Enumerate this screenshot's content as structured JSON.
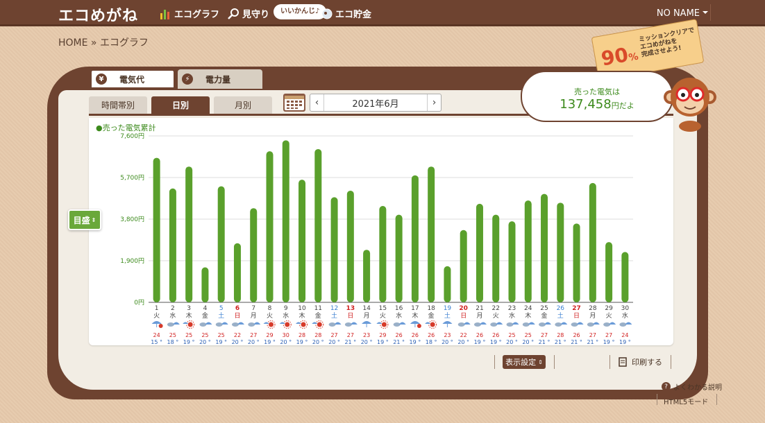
{
  "header": {
    "logo": "エコめがね",
    "nav": [
      {
        "label": "エコグラフ",
        "icon": "bar-chart-icon"
      },
      {
        "label": "見守り",
        "icon": "magnifier-icon"
      },
      {
        "label": "エコ貯金",
        "icon": "piggy-bank-icon"
      }
    ],
    "pill": "いいかんじ♪",
    "user": "NO NAME"
  },
  "breadcrumb": "HOME » エコグラフ",
  "tabs": [
    {
      "label": "電気代",
      "icon_text": "¥"
    },
    {
      "label": "電力量",
      "icon_text": "⚡"
    }
  ],
  "subtabs": [
    "時間帯別",
    "日別",
    "月別"
  ],
  "date": "2021年6月",
  "mission": {
    "percent": "90",
    "unit": "%",
    "text1": "ミッションクリアで",
    "text2": "エコめがねを",
    "text3": "完成させよう!"
  },
  "bubble": {
    "line1": "売った電気は",
    "amount": "137,458",
    "unit": "円だよ"
  },
  "meter_button": "目盛",
  "series_label": "●売った電気累計",
  "colors": {
    "bar": "#5aa02c",
    "brown": "#6e4330",
    "sat": "#3a7fd0",
    "sun": "#d02020",
    "high": "#d02020",
    "low": "#2b5fb3"
  },
  "chart_data": {
    "type": "bar",
    "ylim": [
      0,
      7600
    ],
    "yticks": [
      "0円",
      "1,900円",
      "3,800円",
      "5,700円",
      "7,600円"
    ],
    "ytick_values": [
      0,
      1900,
      3800,
      5700,
      7600
    ],
    "days": [
      "1",
      "2",
      "3",
      "4",
      "5",
      "6",
      "7",
      "8",
      "9",
      "10",
      "11",
      "12",
      "13",
      "14",
      "15",
      "16",
      "17",
      "18",
      "19",
      "20",
      "21",
      "22",
      "23",
      "24",
      "25",
      "26",
      "27",
      "28",
      "29",
      "30"
    ],
    "weekdays": [
      "火",
      "水",
      "木",
      "金",
      "土",
      "日",
      "月",
      "火",
      "水",
      "木",
      "金",
      "土",
      "日",
      "月",
      "火",
      "水",
      "木",
      "金",
      "土",
      "日",
      "月",
      "火",
      "水",
      "木",
      "金",
      "土",
      "日",
      "月",
      "火",
      "水"
    ],
    "day_types": [
      "w",
      "w",
      "w",
      "w",
      "sat",
      "sun",
      "w",
      "w",
      "w",
      "w",
      "w",
      "sat",
      "sun",
      "w",
      "w",
      "w",
      "w",
      "w",
      "sat",
      "sun",
      "w",
      "w",
      "w",
      "w",
      "w",
      "sat",
      "sun",
      "w",
      "w",
      "w"
    ],
    "values": [
      6600,
      5200,
      6200,
      1600,
      5300,
      2700,
      4300,
      6900,
      7400,
      5600,
      7000,
      4800,
      5100,
      2400,
      4400,
      4000,
      5800,
      6200,
      1650,
      3300,
      4500,
      4000,
      3700,
      4650,
      4950,
      4550,
      3600,
      5450,
      2750,
      2300
    ],
    "weather": [
      "rain-sun",
      "cloud-rain",
      "sun-rain",
      "cloud-rain",
      "cloud-rain",
      "cloud-rain",
      "cloud-rain",
      "sun-rain",
      "sun-rain",
      "sun-rain",
      "sun-rain",
      "cloud-rain",
      "cloud-rain",
      "rain",
      "sun-rain",
      "cloud-rain",
      "rain-sun",
      "sun-rain",
      "rain",
      "cloud-rain",
      "cloud-rain",
      "cloud-rain",
      "cloud-rain",
      "cloud-rain",
      "cloud-rain",
      "cloud-rain",
      "cloud-rain",
      "cloud-rain",
      "cloud-rain",
      "cloud-rain"
    ],
    "high": [
      "24",
      "25",
      "25",
      "25",
      "25",
      "22",
      "27",
      "29",
      "30",
      "28",
      "28",
      "27",
      "27",
      "23",
      "29",
      "26",
      "26",
      "26",
      "23",
      "22",
      "26",
      "26",
      "25",
      "25",
      "27",
      "28",
      "26",
      "27",
      "27",
      "24"
    ],
    "low": [
      "15",
      "18",
      "19",
      "20",
      "19",
      "20",
      "20",
      "19",
      "20",
      "19",
      "20",
      "20",
      "21",
      "20",
      "19",
      "21",
      "19",
      "18",
      "20",
      "20",
      "19",
      "19",
      "20",
      "20",
      "21",
      "21",
      "21",
      "21",
      "19",
      "19"
    ],
    "temp_unit": "°"
  },
  "controls": {
    "display_settings": "表示設定",
    "print": "印刷する"
  },
  "footer": {
    "help": "よくわかる説明",
    "html5": "HTML5モード"
  }
}
